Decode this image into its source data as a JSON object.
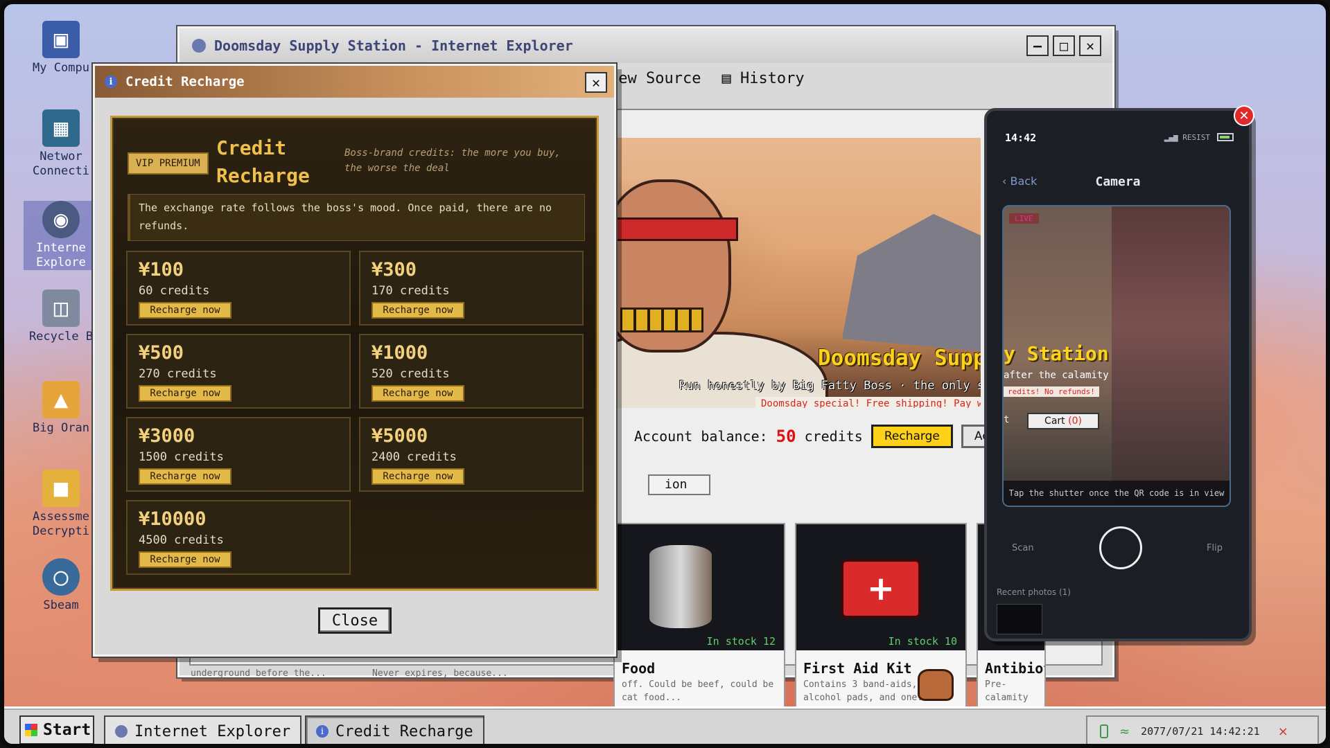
{
  "desktop": {
    "icons": [
      {
        "label": "My Compu",
        "icon": "computer-icon",
        "active": false
      },
      {
        "label": "Networ\nConnecti",
        "icon": "network-icon",
        "active": false
      },
      {
        "label": "Interne\nExplore",
        "icon": "globe-icon",
        "active": true
      },
      {
        "label": "Recycle B",
        "icon": "trash-icon",
        "active": false
      },
      {
        "label": "Big Oran",
        "icon": "cat-icon",
        "active": false
      },
      {
        "label": "Assessme\nDecrypti",
        "icon": "folder-icon",
        "active": false
      },
      {
        "label": "Sbeam",
        "icon": "steam-icon",
        "active": false
      }
    ]
  },
  "browser": {
    "title": "Doomsday Supply Station - Internet Explorer",
    "menu": {
      "view_source": "iew Source",
      "history": "History"
    },
    "banner": {
      "title": "Doomsday Supply",
      "subtitle": "Run honestly by Big Fatty Boss · the only supply dealer af",
      "promo": "Doomsday special! Free shipping! Pay with cre"
    },
    "account": {
      "balance_label": "Account balance:",
      "balance_value": "50",
      "balance_unit": "credits",
      "recharge_label": "Recharge",
      "account_label": "Account"
    },
    "tab_stub": "ion",
    "products": [
      {
        "name": "Food",
        "stock": "In stock 12",
        "desc": "off. Could be beef, could be cat food..."
      },
      {
        "name": "First Aid Kit",
        "stock": "In stock 10",
        "desc": "Contains 3 band-aids, 2 alcohol pads, and one..."
      },
      {
        "name": "Antibioti",
        "stock": "",
        "desc": "Pre-calamity stock. Instructions are blurry;..."
      }
    ],
    "behind_desc": [
      "underground before the...",
      "Never expires, because..."
    ]
  },
  "recharge": {
    "window_title": "Credit Recharge",
    "badge": "VIP PREMIUM",
    "heading": "Credit Recharge",
    "tagline": "Boss-brand credits: the more you buy, the worse the deal",
    "notice": "The exchange rate follows the boss's mood. Once paid, there are no refunds.",
    "packages": [
      {
        "price": "¥100",
        "credits": "60 credits",
        "button": "Recharge now"
      },
      {
        "price": "¥300",
        "credits": "170 credits",
        "button": "Recharge now"
      },
      {
        "price": "¥500",
        "credits": "270 credits",
        "button": "Recharge now"
      },
      {
        "price": "¥1000",
        "credits": "520 credits",
        "button": "Recharge now"
      },
      {
        "price": "¥3000",
        "credits": "1500 credits",
        "button": "Recharge now"
      },
      {
        "price": "¥5000",
        "credits": "2400 credits",
        "button": "Recharge now"
      },
      {
        "price": "¥10000",
        "credits": "4500 credits",
        "button": "Recharge now"
      }
    ],
    "close_label": "Close"
  },
  "phone": {
    "time": "14:42",
    "carrier": "RESIST",
    "back_label": "Back",
    "title": "Camera",
    "live_label": "LIVE",
    "viewfinder": {
      "title": "y Station",
      "subtitle": "after the calamity",
      "promo": "redits! No refunds!",
      "cart_label": "Cart",
      "cart_count": "(0)",
      "left_fragment": "t"
    },
    "hint": "Tap the shutter once the QR code is in view",
    "scan_label": "Scan",
    "flip_label": "Flip",
    "recent_label": "Recent photos (1)"
  },
  "taskbar": {
    "start_label": "Start",
    "tasks": [
      {
        "label": "Internet Explorer",
        "active": false
      },
      {
        "label": "Credit Recharge",
        "active": true
      }
    ],
    "clock": "2077/07/21 14:42:21"
  }
}
